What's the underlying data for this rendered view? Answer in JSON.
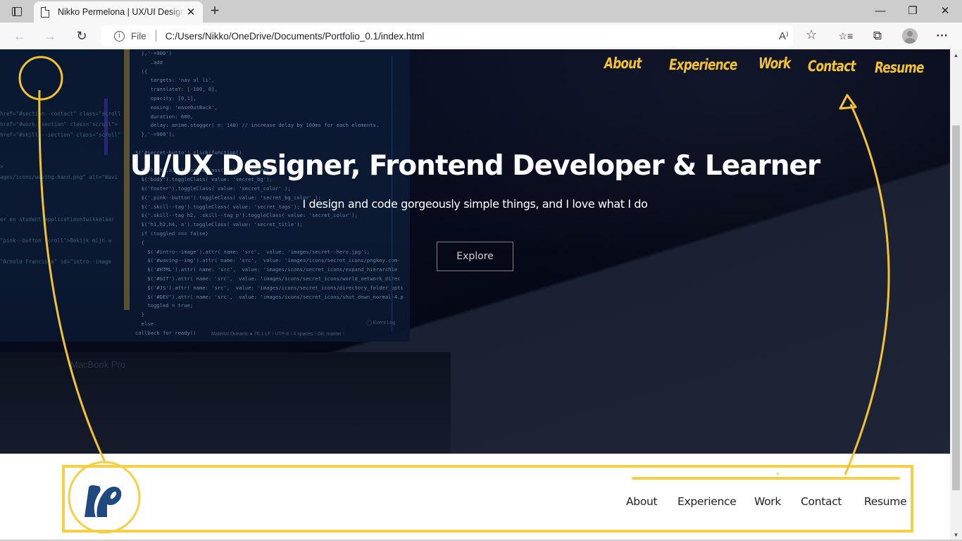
{
  "browser": {
    "tab_title": "Nikko Permelona | UX/UI Designer",
    "tab_icon": "page-icon",
    "new_tab_label": "+",
    "window_controls": {
      "minimize": "—",
      "restore": "❐",
      "close": "✕"
    },
    "nav": {
      "back": "←",
      "forward": "→",
      "refresh": "↻"
    },
    "address": {
      "scheme": "File",
      "url": "C:/Users/Nikko/OneDrive/Documents/Portfolio_0.1/index.html"
    },
    "toolbar_icons": [
      "read-aloud-icon",
      "add-favorite-icon",
      "favorites-icon",
      "collections-icon",
      "profile-avatar",
      "more-icon"
    ],
    "glyphs": {
      "read_aloud": "A⁾",
      "add_fav": "☆",
      "favorites": "☆≡",
      "collections": "⧉",
      "more": "···",
      "close_tab": "✕",
      "info": "i"
    }
  },
  "hero": {
    "title": "UI/UX Designer, Frontend Developer & Learner",
    "subtitle": "I design and code gorgeously simple things, and I love what I do",
    "explore_button": "Explore",
    "laptop_label": "MacBook Pro",
    "handwritten_nav": [
      "About",
      "Experience",
      "Work",
      "Contact",
      "Resume"
    ],
    "code_left_lines": [
      "href=\"#section--contact\" class=\"scroll",
      "href=\"#work--section\" class=\"scroll\">",
      "href=\"#skills--section\" class=\"scroll\"",
      "",
      "",
      ">",
      "ages/icons/waving-hand.png\" alt=\"Wavi",
      "",
      "",
      "",
      "er en student applicatieontwikkelaar",
      "",
      "\"pink--button scroll\">Bekijk mijn w",
      "",
      "\"Arnold Francisca\" id=\"intro--image"
    ],
    "code_main_lines": [
      "  },'-=900')",
      "     .add",
      "  ({",
      "     targets: 'nav ul li',",
      "     translateY: [-100, 0],",
      "     opacity: [0,1],",
      "     easing: 'easeOutBack',",
      "     duration: 600,",
      "     delay: anime.stagger( n: 140) // increase delay by 100ms for each elements.",
      "  },'-=900');",
      "",
      "$('#secret-butto').click(function()",
      "{",
      "  $('h1,h2,a,p').toggleClass( value: 'secret');",
      "  $('body').toggleClass( value: 'secret_bg');",
      "  $('footer').toggleClass( value: 'secret_color' );",
      "  $('.pink--button').toggleClass( value: 'secret_bg_color' );",
      "  $('.skill--tag').toggleClass( value: 'secret_tags');",
      "  $('.skill--tag h2, .skill--tag p').toggleClass( value: 'secret_color');",
      "  $('h1,h2,h4, a').toggleClass( value: 'secret_title');",
      "  if (toggled === false)",
      "  {",
      "    $('#intro--image').attr( name: 'src',  value: 'images/secret--hero.jpg');",
      "    $('#waving--img').attr( name: 'src',  value: 'images/icons/secret_icons/pngkey.com-",
      "    $('#HTML').attr( name: 'src',  value: 'images/icons/secret_icons/expand_hierarchie",
      "    $('#GIT').attr( name: 'src',  value: 'images/icons/secret_icons/world_network_direc",
      "    $('#JS').attr( name: 'src',  value: 'images/icons/secret_icons/directory_folder_opti",
      "    $('#DEV').attr( name: 'src',  value: 'images/icons/secret_icons/shut_down_normal-4.p",
      "    toggled = true;",
      "  }",
      "  else",
      "callback for ready()"
    ],
    "editor_status": "Material Oceanic  ●  76:1  LF ⁝  UTF-8 ⁝  4 spaces ⁝  Git: master ⁝",
    "event_log": "◯ Event Log"
  },
  "header_band": {
    "logo_alt": "NP",
    "nav": [
      "About",
      "Experience",
      "Work",
      "Contact",
      "Resume"
    ]
  },
  "colors": {
    "accent_yellow": "#f7cf45",
    "hero_bg": "#060a1a",
    "logo_blue": "#1f4a7f",
    "nav_text": "#222222"
  }
}
